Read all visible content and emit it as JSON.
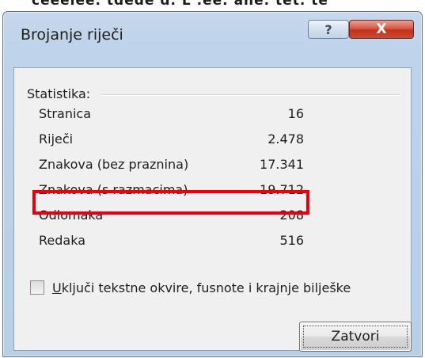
{
  "background_text": "ceeelee. tdede d. L .ee. ane. tet. te",
  "window": {
    "title": "Brojanje riječi",
    "help_label": "?",
    "close_label": "X"
  },
  "statistics": {
    "group_label": "Statistika:",
    "rows": [
      {
        "label": "Stranica",
        "value": "16"
      },
      {
        "label": "Riječi",
        "value": "2.478"
      },
      {
        "label": "Znakova (bez praznina)",
        "value": "17.341"
      },
      {
        "label": "Znakova (s razmacima)",
        "value": "19.712"
      },
      {
        "label": "Odlomaka",
        "value": "208"
      },
      {
        "label": "Redaka",
        "value": "516"
      }
    ]
  },
  "options": {
    "include_mnemonic": "U",
    "include_label_rest": "ključi tekstne okvire, fusnote i krajnje bilješke",
    "checked": false
  },
  "buttons": {
    "close_label": "Zatvori"
  },
  "colors": {
    "highlight": "#e8000c",
    "title_bar": "#c6d8ec",
    "close_button": "#c2311c"
  }
}
